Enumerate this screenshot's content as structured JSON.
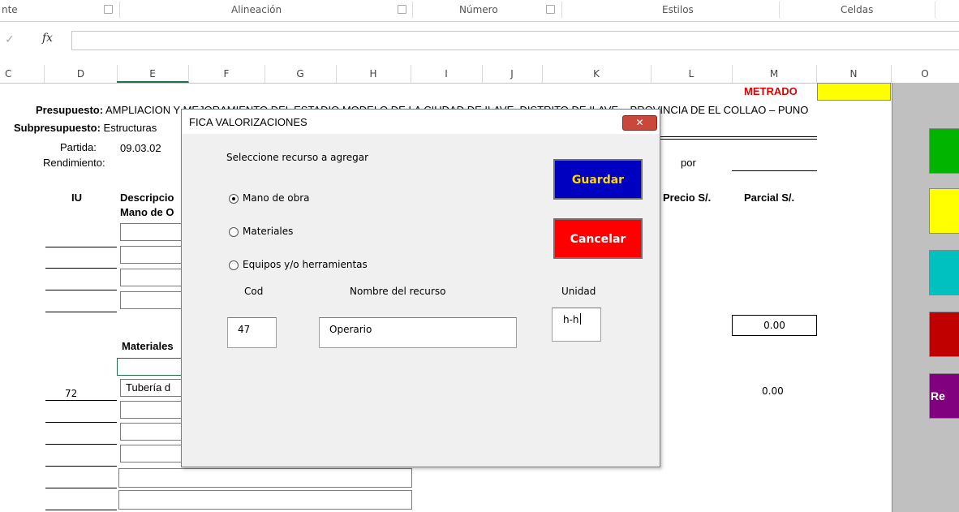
{
  "ribbon": {
    "groups": [
      "nte",
      "Alineación",
      "Número",
      "Estilos",
      "Celdas"
    ]
  },
  "formula_bar": {
    "check_icon": "✓",
    "fx_label": "fx",
    "value": ""
  },
  "columns": [
    "C",
    "D",
    "E",
    "F",
    "G",
    "H",
    "I",
    "J",
    "K",
    "L",
    "M",
    "N",
    "O"
  ],
  "sheet": {
    "metrado_label": "METRADO",
    "presupuesto_label": "Presupuesto:",
    "presupuesto_value": "AMPLIACION Y MEJORAMIENTO DEL ESTADIO MODELO DE LA CIUDAD DE ILAVE, DISTRITO DE ILAVE – PROVINCIA DE EL COLLAO – PUNO",
    "subpresupuesto_label": "Subpresupuesto:",
    "subpresupuesto_value": "Estructuras",
    "partida_label": "Partida:",
    "partida_value": "09.03.02",
    "rendimiento_label": "Rendimiento:",
    "por_label": "por",
    "iu_header": "IU",
    "descripcion_header": "Descripcio",
    "mano_obra_header": "Mano de O",
    "precio_header": "Precio S/.",
    "parcial_header": "Parcial S/.",
    "mano_obra_total": "0.00",
    "materiales_header": "Materiales",
    "material_row_iu": "72",
    "material_row_desc": "Tubería d",
    "materiales_total": "0.00"
  },
  "side_panel": {
    "buttons": [
      {
        "color": "#00b400",
        "label": ""
      },
      {
        "color": "#ffff00",
        "label": ""
      },
      {
        "color": "#00c0c0",
        "label": ""
      },
      {
        "color": "#c00000",
        "label": ""
      },
      {
        "color": "#800080",
        "label": "Re"
      }
    ]
  },
  "dialog": {
    "title": "FICA VALORIZACIONES",
    "close_label": "✕",
    "prompt": "Seleccione recurso a agregar",
    "options": [
      {
        "label": "Mano de obra",
        "selected": true
      },
      {
        "label": "Materiales",
        "selected": false
      },
      {
        "label": "Equipos y/o herramientas",
        "selected": false
      }
    ],
    "save_label": "Guardar",
    "cancel_label": "Cancelar",
    "cod_label": "Cod",
    "nombre_label": "Nombre del recurso",
    "unidad_label": "Unidad",
    "cod_value": "47",
    "nombre_value": "Operario",
    "unidad_value": "h-h"
  }
}
